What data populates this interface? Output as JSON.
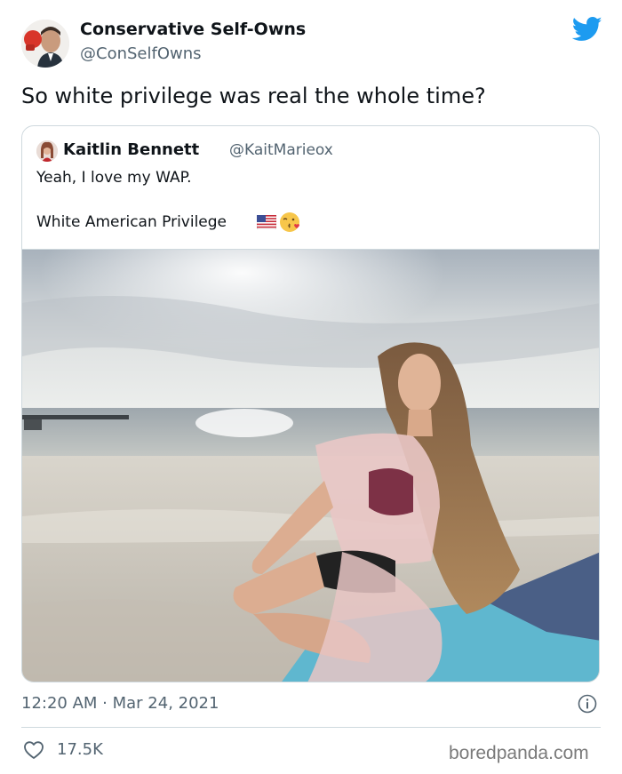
{
  "author": {
    "display_name": "Conservative Self-Owns",
    "handle": "@ConSelfOwns",
    "avatar": "avatar-photo-with-boxing-glove"
  },
  "tweet": {
    "text": "So white privilege was real the whole time?"
  },
  "quoted_tweet": {
    "display_name": "Kaitlin Bennett",
    "handle": "@KaitMarieox",
    "line1": "Yeah, I love my WAP.",
    "line2": "White American Privilege",
    "emojis": [
      "us-flag-icon",
      "face-blowing-kiss-icon"
    ],
    "photo": "woman-sitting-on-beach-photo"
  },
  "meta": {
    "timestamp": "12:20 AM · Mar 24, 2021",
    "likes": "17.5K"
  },
  "watermark": "boredpanda.com",
  "colors": {
    "twitter_blue": "#1d9bf0",
    "secondary_text": "#536471",
    "border": "#cfd9de"
  }
}
